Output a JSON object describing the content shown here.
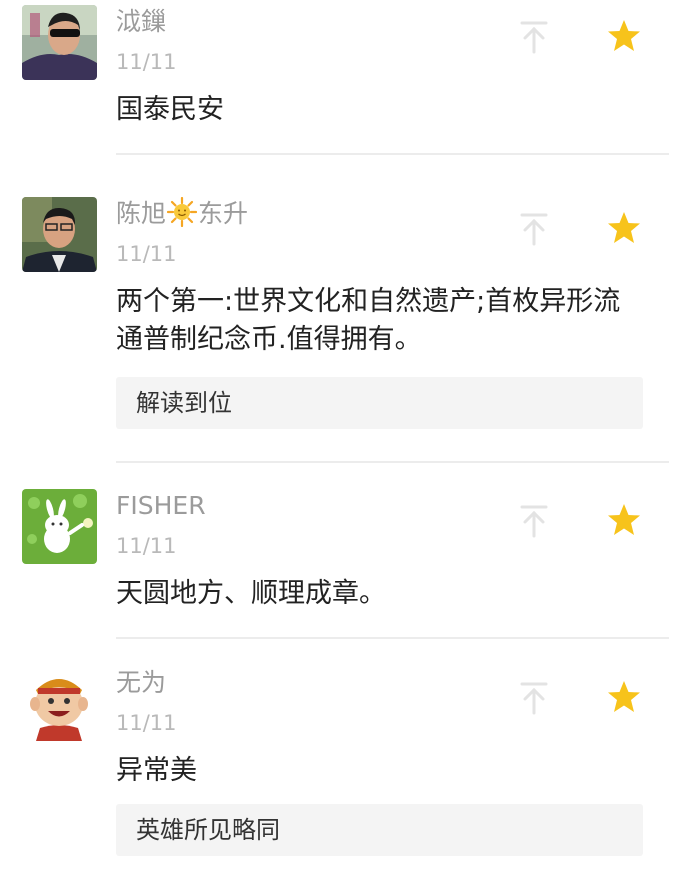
{
  "accent_star_color": "#F7C31B",
  "pin_icon_color": "#E3E3E3",
  "comments": [
    {
      "nickname": "泧鏁",
      "date": "11/11",
      "text": "国泰民安",
      "icons": [
        "pin-top-icon",
        "star-icon"
      ]
    },
    {
      "nickname_part1": "陈旭",
      "nickname_emoji": "sun-emoji-icon",
      "nickname_part2": "东升",
      "date": "11/11",
      "text": "两个第一:世界文化和自然遗产;首枚异形流通普制纪念币.值得拥有。",
      "reply": "解读到位",
      "icons": [
        "pin-top-icon",
        "star-icon"
      ]
    },
    {
      "nickname": "FISHER",
      "date": "11/11",
      "text": "天圆地方、顺理成章。",
      "icons": [
        "pin-top-icon",
        "star-icon"
      ]
    },
    {
      "nickname": "无为",
      "date": "11/11",
      "text": "异常美",
      "reply": "英雄所见略同",
      "icons": [
        "pin-top-icon",
        "star-icon"
      ]
    }
  ]
}
